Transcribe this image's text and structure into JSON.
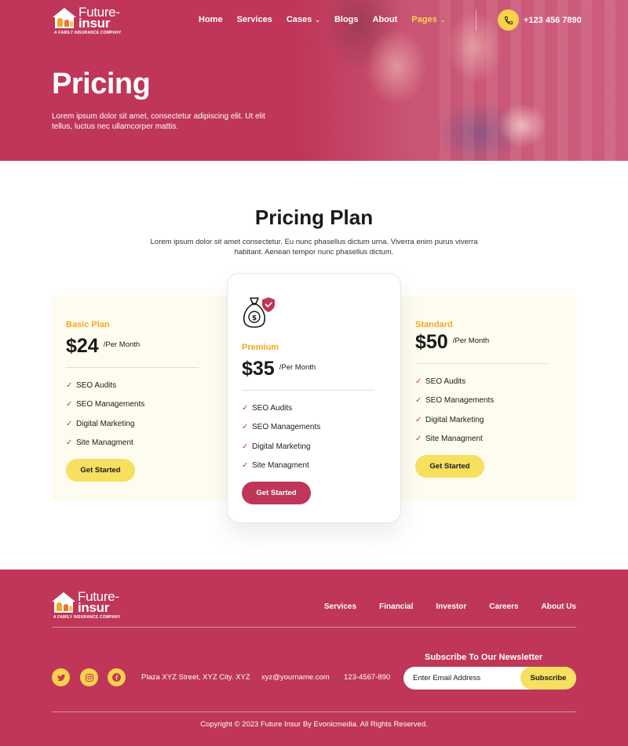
{
  "header": {
    "logo": {
      "word1": "Future-",
      "word2": "insur",
      "tagline": "A FAMILY INSURANCE COMPANY"
    },
    "nav": [
      {
        "label": "Home",
        "has_dropdown": false,
        "active": false
      },
      {
        "label": "Services",
        "has_dropdown": false,
        "active": false
      },
      {
        "label": "Cases",
        "has_dropdown": true,
        "active": false
      },
      {
        "label": "Blogs",
        "has_dropdown": false,
        "active": false
      },
      {
        "label": "About",
        "has_dropdown": false,
        "active": false
      },
      {
        "label": "Pages",
        "has_dropdown": true,
        "active": true
      }
    ],
    "phone": "+123 456 7890"
  },
  "hero": {
    "title": "Pricing",
    "description": "Lorem ipsum dolor sit amet, consectetur adipiscing elit. Ut elit tellus, luctus nec ullamcorper mattis."
  },
  "pricing": {
    "title": "Pricing Plan",
    "description": "Lorem ipsum dolor sit amet consectetur. Eu nunc phasellus dictum urna. Viverra enim purus viverra habitant. Aenean tempor nunc phasellus dictum.",
    "plans": [
      {
        "name": "Basic Plan",
        "price": "$24",
        "period": "/Per Month",
        "features": [
          "SEO Audits",
          "SEO Managements",
          "Digital Marketing",
          "Site Managment"
        ],
        "cta": "Get Started"
      },
      {
        "name": "Premium",
        "price": "$35",
        "period": "/Per Month",
        "features": [
          "SEO Audits",
          "SEO Managements",
          "Digital Marketing",
          "Site Managment"
        ],
        "cta": "Get Started",
        "icon": "money-bag-icon"
      },
      {
        "name": "Standard",
        "price": "$50",
        "period": "/Per Month",
        "features": [
          "SEO Audits",
          "SEO Managements",
          "Digital Marketing",
          "Site Managment"
        ],
        "cta": "Get Started"
      }
    ]
  },
  "footer": {
    "logo": {
      "word1": "Future-",
      "word2": "insur",
      "tagline": "A FAMILY INSURANCE COMPANY"
    },
    "nav": [
      "Services",
      "Financial",
      "Investor",
      "Careers",
      "About Us"
    ],
    "social": [
      "twitter-icon",
      "instagram-icon",
      "facebook-icon"
    ],
    "address": "Plaza XYZ Street, XYZ City. XYZ",
    "email": "xyz@yourname.com",
    "phone": "123-4567-890",
    "newsletter": {
      "title": "Subscribe To Our Newsletter",
      "placeholder": "Enter Email Address",
      "button": "Subscribe"
    },
    "copyright": "Copyright © 2023 Future Insur By Evonicmedia. All Rights Reserved."
  },
  "colors": {
    "brand": "#bf3658",
    "accent": "#f7d24b",
    "button_yellow": "#f7df60",
    "plan_name": "#f5a623",
    "card_bg": "#fefcef"
  }
}
